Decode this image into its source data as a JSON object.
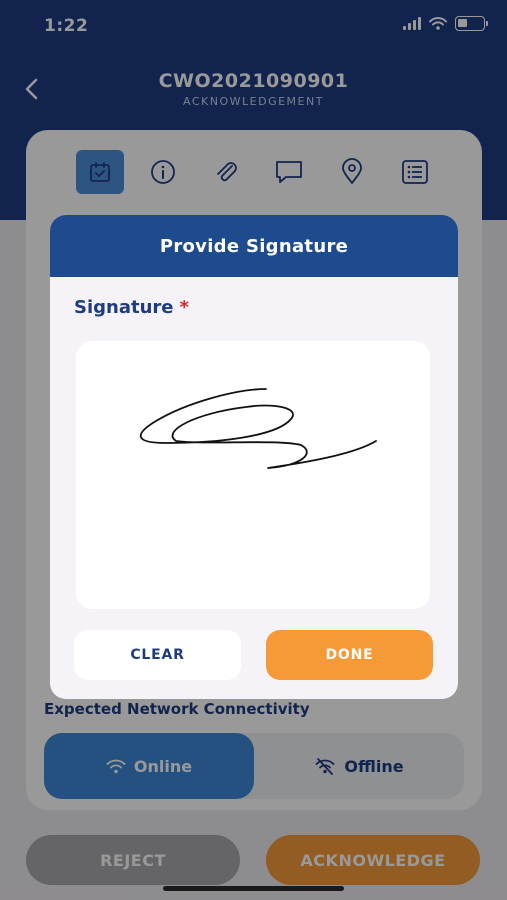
{
  "status_bar": {
    "time": "1:22"
  },
  "header": {
    "title": "CWO2021090901",
    "subtitle": "ACKNOWLEDGEMENT"
  },
  "tabs": [
    {
      "icon": "calendar-check-icon",
      "active": true
    },
    {
      "icon": "info-icon",
      "active": false
    },
    {
      "icon": "paperclip-icon",
      "active": false
    },
    {
      "icon": "chat-bubble-icon",
      "active": false
    },
    {
      "icon": "location-pin-icon",
      "active": false
    },
    {
      "icon": "list-icon",
      "active": false
    }
  ],
  "network": {
    "label": "Expected Network Connectivity",
    "online_label": "Online",
    "offline_label": "Offline",
    "selected": "Online"
  },
  "actions": {
    "reject_label": "REJECT",
    "acknowledge_label": "ACKNOWLEDGE"
  },
  "dialog": {
    "title": "Provide Signature",
    "signature_label": "Signature",
    "required_mark": "*",
    "clear_label": "CLEAR",
    "done_label": "DONE"
  },
  "colors": {
    "primary": "#1e3c82",
    "accent_orange": "#f69a37",
    "active_blue": "#3f88d6",
    "required_red": "#d8232a"
  }
}
